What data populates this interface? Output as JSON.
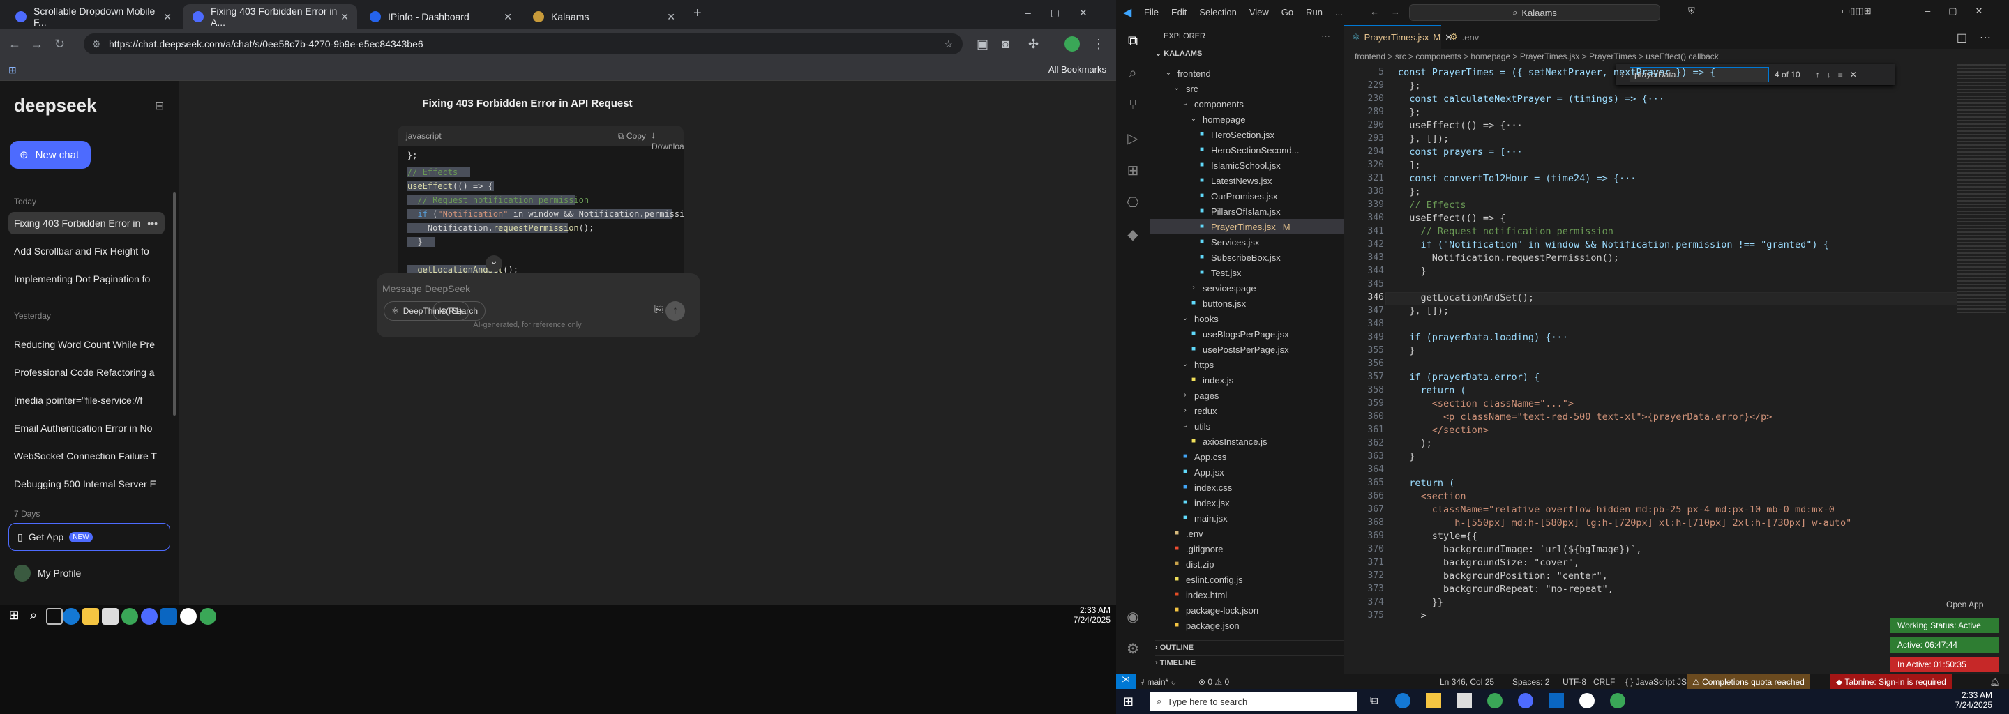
{
  "chrome": {
    "tabs": [
      {
        "label": "Scrollable Dropdown Mobile F...",
        "active": false
      },
      {
        "label": "Fixing 403 Forbidden Error in A...",
        "active": true
      },
      {
        "label": "IPinfo - Dashboard",
        "active": false
      },
      {
        "label": "Kalaams",
        "active": false
      }
    ],
    "new_tab": "+",
    "url": "https://chat.deepseek.com/a/chat/s/0ee58c7b-4270-9b9e-e5ec84343be6",
    "all_bookmarks": "All Bookmarks"
  },
  "deepseek": {
    "logo": "deepseek",
    "new_chat": "New chat",
    "sections": [
      {
        "heading": "Today",
        "items": [
          "Fixing 403 Forbidden Error in",
          "Add Scrollbar and Fix Height fo",
          "Implementing Dot Pagination fo"
        ]
      },
      {
        "heading": "Yesterday",
        "items": [
          "Reducing Word Count While Pre",
          "Professional Code Refactoring a",
          "[media pointer=\"file-service://f",
          "Email Authentication Error in No",
          "WebSocket Connection Failure T",
          "Debugging 500 Internal Server E"
        ]
      },
      {
        "heading": "7 Days",
        "items": []
      }
    ],
    "get_app": "Get App",
    "new_badge": "NEW",
    "profile": "My Profile",
    "chat_title": "Fixing 403 Forbidden Error in API Request",
    "code_lang": "javascript",
    "copy": "Copy",
    "download": "Download",
    "message_placeholder": "Message DeepSeek",
    "deepthink": "DeepThink (R1)",
    "search": "Search",
    "disclaimer": "AI-generated, for reference only"
  },
  "left_taskbar": {
    "time": "2:33 AM",
    "date": "7/24/2025"
  },
  "vscode": {
    "menu": [
      "File",
      "Edit",
      "Selection",
      "View",
      "Go",
      "Run",
      "..."
    ],
    "search": "Kalaams",
    "explorer_title": "EXPLORER",
    "workspace": "KALAAMS",
    "tree": [
      {
        "label": "frontend",
        "depth": 1,
        "type": "folder"
      },
      {
        "label": "src",
        "depth": 2,
        "type": "folder"
      },
      {
        "label": "components",
        "depth": 3,
        "type": "folder"
      },
      {
        "label": "homepage",
        "depth": 4,
        "type": "folder"
      },
      {
        "label": "HeroSection.jsx",
        "depth": 5,
        "type": "jsx"
      },
      {
        "label": "HeroSectionSecond...",
        "depth": 5,
        "type": "jsx"
      },
      {
        "label": "IslamicSchool.jsx",
        "depth": 5,
        "type": "jsx"
      },
      {
        "label": "LatestNews.jsx",
        "depth": 5,
        "type": "jsx"
      },
      {
        "label": "OurPromises.jsx",
        "depth": 5,
        "type": "jsx"
      },
      {
        "label": "PillarsOfIslam.jsx",
        "depth": 5,
        "type": "jsx"
      },
      {
        "label": "PrayerTimes.jsx",
        "depth": 5,
        "type": "jsx",
        "badge": "M",
        "selected": true
      },
      {
        "label": "Services.jsx",
        "depth": 5,
        "type": "jsx"
      },
      {
        "label": "SubscribeBox.jsx",
        "depth": 5,
        "type": "jsx"
      },
      {
        "label": "Test.jsx",
        "depth": 5,
        "type": "jsx"
      },
      {
        "label": "servicespage",
        "depth": 4,
        "type": "folder-c"
      },
      {
        "label": "buttons.jsx",
        "depth": 4,
        "type": "jsx"
      },
      {
        "label": "hooks",
        "depth": 3,
        "type": "folder"
      },
      {
        "label": "useBlogsPerPage.jsx",
        "depth": 4,
        "type": "jsx"
      },
      {
        "label": "usePostsPerPage.jsx",
        "depth": 4,
        "type": "jsx"
      },
      {
        "label": "https",
        "depth": 3,
        "type": "folder"
      },
      {
        "label": "index.js",
        "depth": 4,
        "type": "js"
      },
      {
        "label": "pages",
        "depth": 3,
        "type": "folder-c"
      },
      {
        "label": "redux",
        "depth": 3,
        "type": "folder-c"
      },
      {
        "label": "utils",
        "depth": 3,
        "type": "folder"
      },
      {
        "label": "axiosInstance.js",
        "depth": 4,
        "type": "js"
      },
      {
        "label": "App.css",
        "depth": 3,
        "type": "css"
      },
      {
        "label": "App.jsx",
        "depth": 3,
        "type": "jsx"
      },
      {
        "label": "index.css",
        "depth": 3,
        "type": "css"
      },
      {
        "label": "index.jsx",
        "depth": 3,
        "type": "jsx"
      },
      {
        "label": "main.jsx",
        "depth": 3,
        "type": "jsx"
      },
      {
        "label": ".env",
        "depth": 2,
        "type": "env"
      },
      {
        "label": ".gitignore",
        "depth": 2,
        "type": "git"
      },
      {
        "label": "dist.zip",
        "depth": 2,
        "type": "zip"
      },
      {
        "label": "eslint.config.js",
        "depth": 2,
        "type": "js"
      },
      {
        "label": "index.html",
        "depth": 2,
        "type": "html"
      },
      {
        "label": "package-lock.json",
        "depth": 2,
        "type": "json"
      },
      {
        "label": "package.json",
        "depth": 2,
        "type": "json"
      }
    ],
    "outline": "OUTLINE",
    "timeline": "TIMELINE",
    "tabs": [
      {
        "label": "PrayerTimes.jsx",
        "badge": "M",
        "active": true
      },
      {
        "label": ".env",
        "active": false
      }
    ],
    "breadcrumb": "frontend > src > components > homepage > PrayerTimes.jsx > PrayerTimes > useEffect() callback",
    "find": {
      "query": "prayerData",
      "count": "4 of 10"
    },
    "code": [
      {
        "n": "5",
        "t": "const PrayerTimes = ({ setNextPrayer, nextPrayer }) => {"
      },
      {
        "n": "229",
        "t": "  };"
      },
      {
        "n": "230",
        "t": "  const calculateNextPrayer = (timings) => {···"
      },
      {
        "n": "289",
        "t": "  };"
      },
      {
        "n": "290",
        "t": "  useEffect(() => {···"
      },
      {
        "n": "293",
        "t": "  }, []);"
      },
      {
        "n": "294",
        "t": "  const prayers = [···"
      },
      {
        "n": "320",
        "t": "  ];"
      },
      {
        "n": "321",
        "t": "  const convertTo12Hour = (time24) => {···"
      },
      {
        "n": "338",
        "t": "  };"
      },
      {
        "n": "339",
        "t": "  // Effects"
      },
      {
        "n": "340",
        "t": "  useEffect(() => {"
      },
      {
        "n": "341",
        "t": "    // Request notification permission"
      },
      {
        "n": "342",
        "t": "    if (\"Notification\" in window && Notification.permission !== \"granted\") {"
      },
      {
        "n": "343",
        "t": "      Notification.requestPermission();"
      },
      {
        "n": "344",
        "t": "    }"
      },
      {
        "n": "345",
        "t": ""
      },
      {
        "n": "346",
        "t": "    getLocationAndSet();"
      },
      {
        "n": "347",
        "t": "  }, []);"
      },
      {
        "n": "348",
        "t": ""
      },
      {
        "n": "349",
        "t": "  if (prayerData.loading) {···"
      },
      {
        "n": "355",
        "t": "  }"
      },
      {
        "n": "356",
        "t": ""
      },
      {
        "n": "357",
        "t": "  if (prayerData.error) {"
      },
      {
        "n": "358",
        "t": "    return ("
      },
      {
        "n": "359",
        "t": "      <section className=\"...\">"
      },
      {
        "n": "360",
        "t": "        <p className=\"text-red-500 text-xl\">{prayerData.error}</p>"
      },
      {
        "n": "361",
        "t": "      </section>"
      },
      {
        "n": "362",
        "t": "    );"
      },
      {
        "n": "363",
        "t": "  }"
      },
      {
        "n": "364",
        "t": ""
      },
      {
        "n": "365",
        "t": "  return ("
      },
      {
        "n": "366",
        "t": "    <section"
      },
      {
        "n": "367",
        "t": "      className=\"relative overflow-hidden md:pb-25 px-4 md:px-10 mb-0 md:mx-0"
      },
      {
        "n": "368",
        "t": "          h-[550px] md:h-[580px] lg:h-[720px] xl:h-[710px] 2xl:h-[730px] w-auto\""
      },
      {
        "n": "369",
        "t": "      style={{"
      },
      {
        "n": "370",
        "t": "        backgroundImage: `url(${bgImage})`,"
      },
      {
        "n": "371",
        "t": "        backgroundSize: \"cover\","
      },
      {
        "n": "372",
        "t": "        backgroundPosition: \"center\","
      },
      {
        "n": "373",
        "t": "        backgroundRepeat: \"no-repeat\","
      },
      {
        "n": "374",
        "t": "      }}"
      },
      {
        "n": "375",
        "t": "    >"
      }
    ],
    "status": {
      "branch": "main*",
      "problems": "⊗ 0 ⚠ 0",
      "position": "Ln 346, Col 25",
      "spaces": "Spaces: 2",
      "encoding": "UTF-8",
      "eol": "CRLF",
      "language": "JavaScript JSX",
      "quota": "Completions quota reached",
      "tabnine": "Tabnine: Sign-in is required"
    },
    "widgets": {
      "open_app": "Open App",
      "working": "Working Status: Active",
      "active": "Active: 06:47:44",
      "inactive": "In Active: 01:50:35"
    }
  },
  "win_taskbar": {
    "search": "Type here to search",
    "time": "2:33 AM",
    "date": "7/24/2025"
  }
}
